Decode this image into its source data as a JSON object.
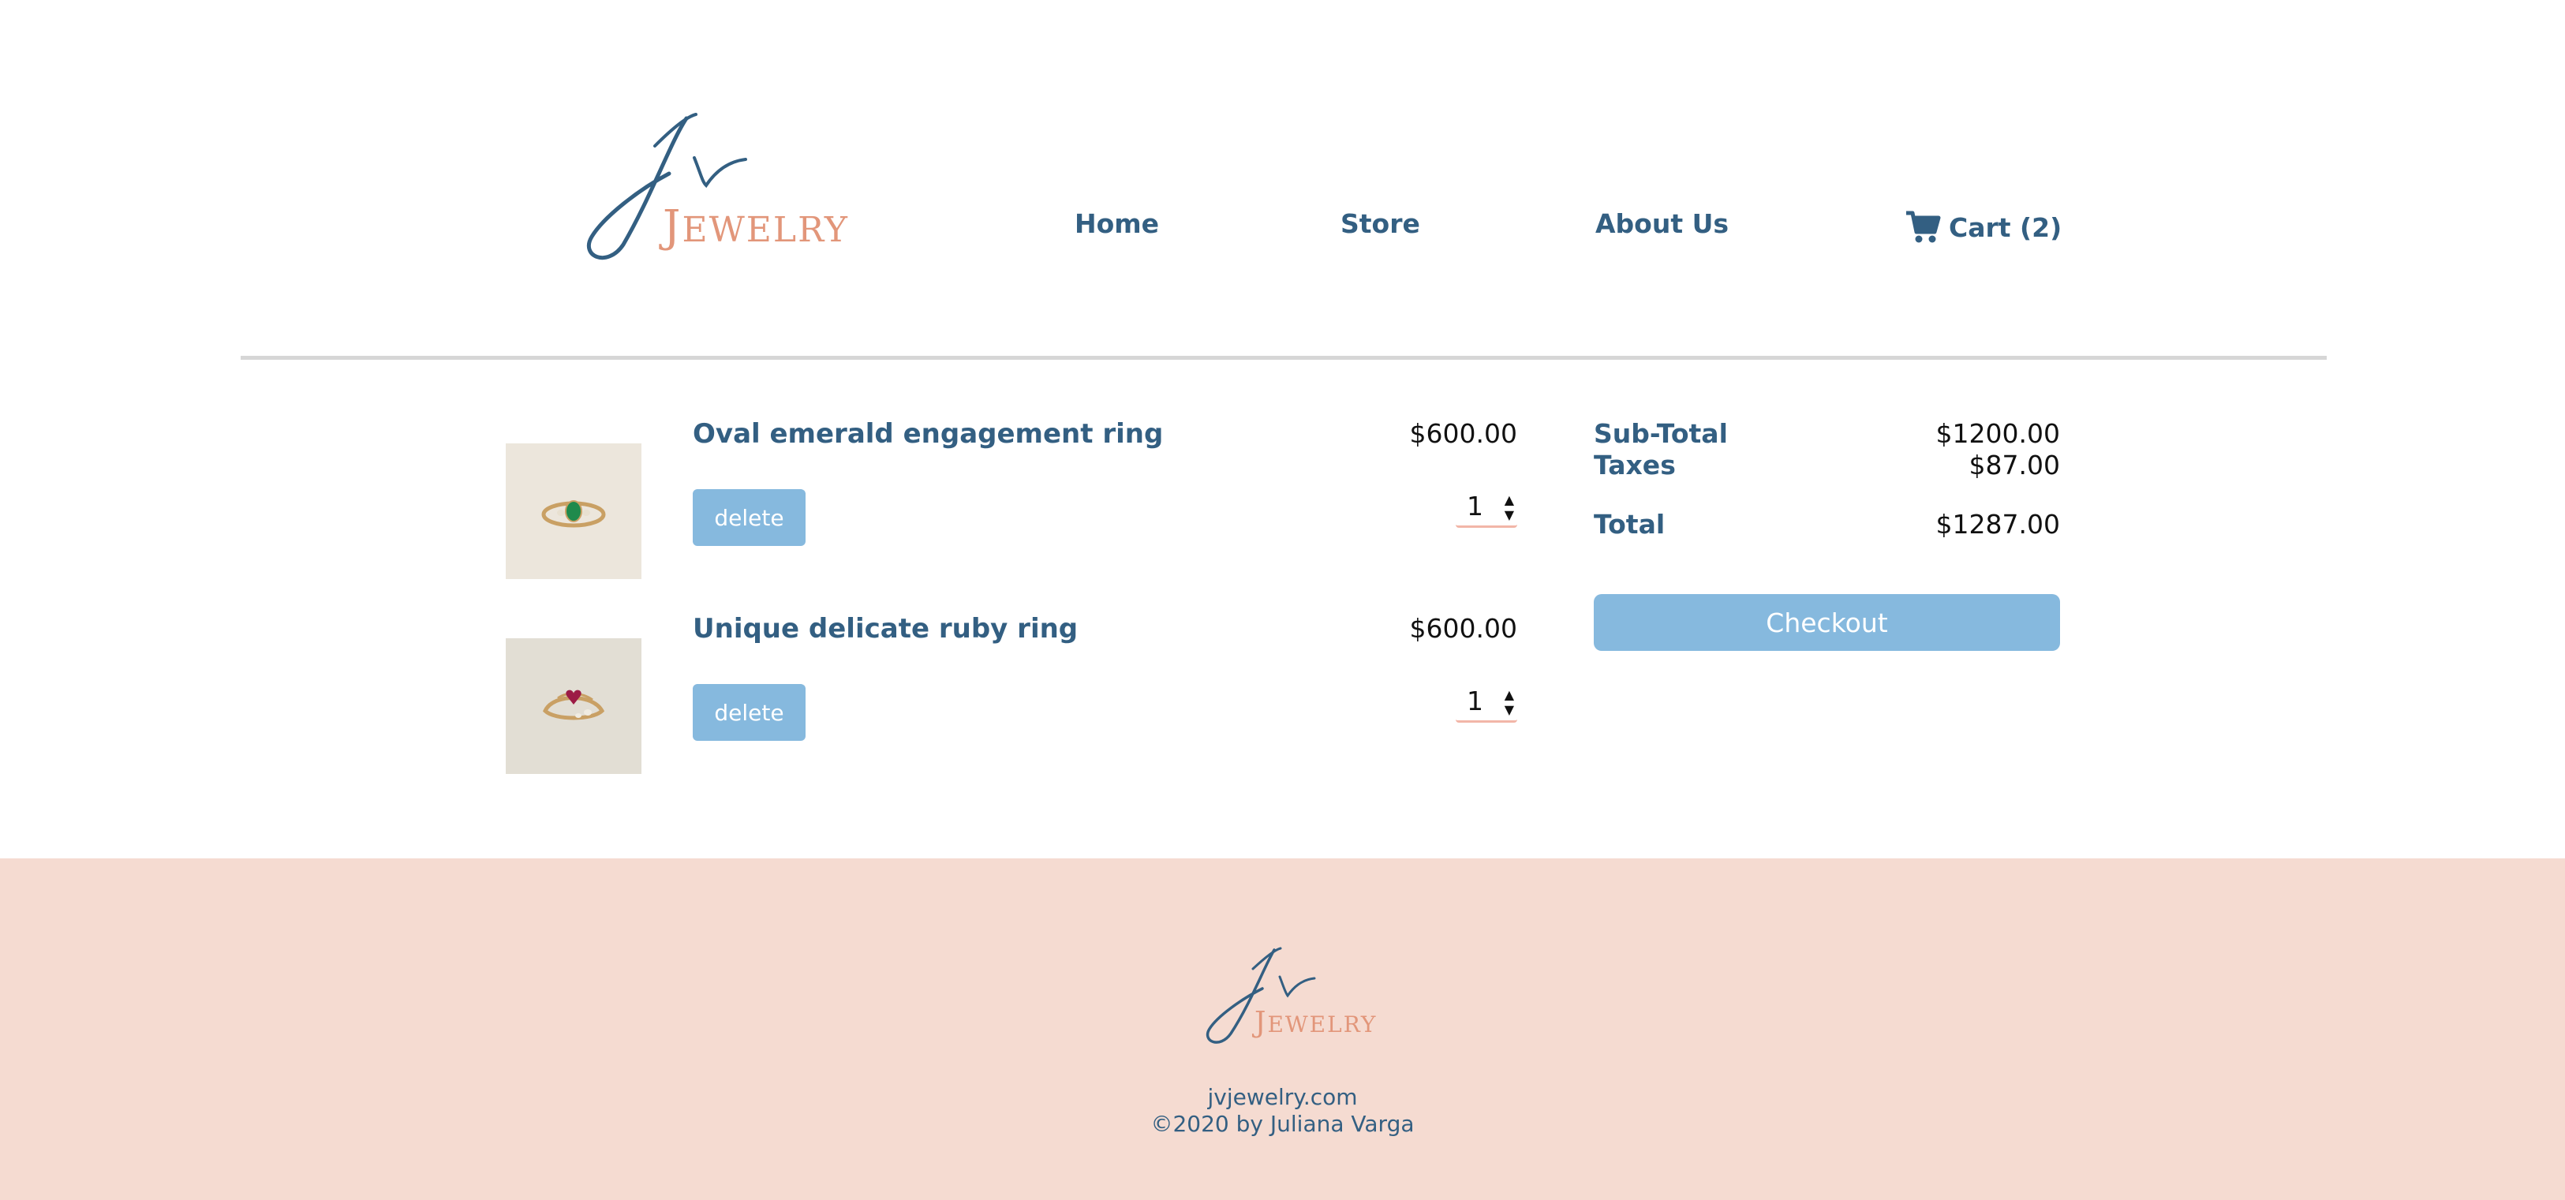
{
  "brand": {
    "logo_initials": "Jv",
    "logo_word_first": "J",
    "logo_word_rest": "EWELRY",
    "colors": {
      "primary_text": "#335f82",
      "accent": "#e2967a",
      "button": "#86b9de",
      "footer_bg": "#f5dbd1"
    }
  },
  "nav": {
    "home": "Home",
    "store": "Store",
    "about": "About Us",
    "cart": "Cart (2)",
    "cart_icon": "cart-icon"
  },
  "cart": {
    "items": [
      {
        "name": "Oval emerald engagement ring",
        "price": "$600.00",
        "quantity": "1",
        "delete_label": "delete",
        "gem_color": "#1f8a4c"
      },
      {
        "name": "Unique delicate ruby ring",
        "price": "$600.00",
        "quantity": "1",
        "delete_label": "delete",
        "gem_color": "#9c1b45"
      }
    ]
  },
  "summary": {
    "subtotal_label": "Sub-Total",
    "subtotal_value": "$1200.00",
    "taxes_label": "Taxes",
    "taxes_value": "$87.00",
    "total_label": "Total",
    "total_value": "$1287.00",
    "checkout_label": "Checkout"
  },
  "footer": {
    "site": "jvjewelry.com",
    "copyright": "©2020 by Juliana Varga"
  }
}
